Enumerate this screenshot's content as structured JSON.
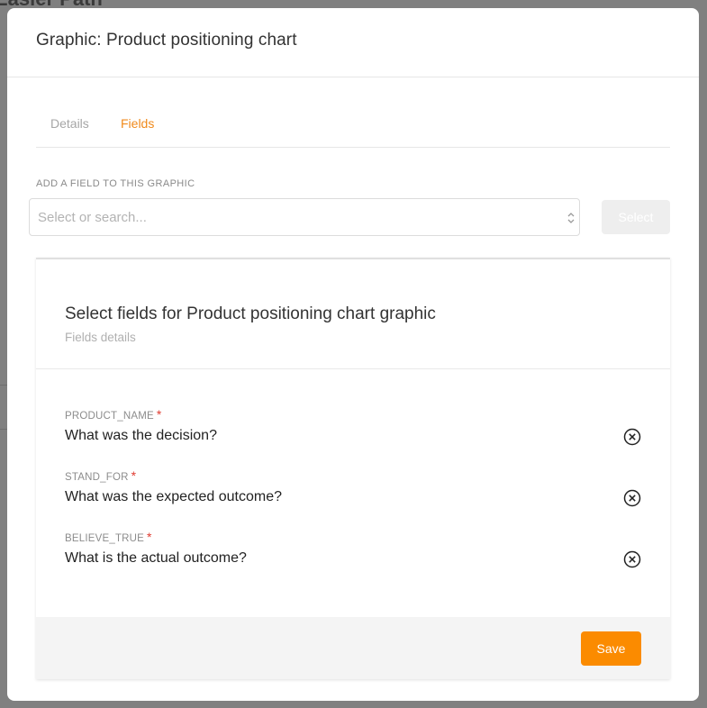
{
  "background": {
    "title": "Easier Path"
  },
  "modal": {
    "title": "Graphic: Product positioning chart"
  },
  "tabs": [
    {
      "label": "Details"
    },
    {
      "label": "Fields"
    }
  ],
  "add_field": {
    "label": "ADD A FIELD TO THIS GRAPHIC",
    "placeholder": "Select or search...",
    "select_label": "Select"
  },
  "panel": {
    "title": "Select fields for Product positioning chart graphic",
    "subtitle": "Fields details",
    "fields": [
      {
        "name": "PRODUCT_NAME",
        "required": "*",
        "value": "What was the decision?"
      },
      {
        "name": "STAND_FOR",
        "required": "*",
        "value": "What was the expected outcome?"
      },
      {
        "name": "BELIEVE_TRUE",
        "required": "*",
        "value": "What is the actual outcome?"
      }
    ],
    "save_label": "Save"
  },
  "colors": {
    "accent": "#fb8b00",
    "active_tab": "#f08a1c",
    "required": "#e03c31"
  },
  "icons": {
    "remove": "circle-x-icon",
    "select": "chevron-up-down-icon"
  }
}
